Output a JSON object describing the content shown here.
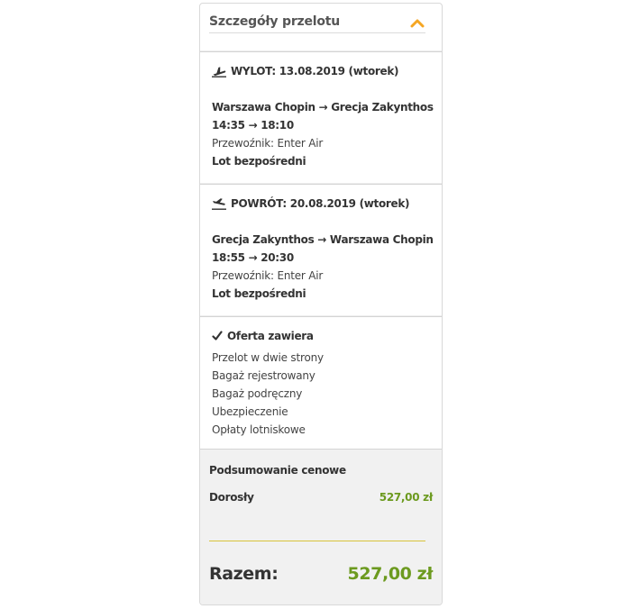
{
  "header": {
    "title": "Szczegóły przelotu",
    "toggle_icon": "chevron-up-icon",
    "accent_color": "#f5a623"
  },
  "outbound": {
    "icon": "plane-takeoff-icon",
    "heading": "WYLOT: 13.08.2019 (wtorek)",
    "route": "Warszawa Chopin → Grecja Zakynthos",
    "times": "14:35 → 18:10",
    "carrier": "Przewoźnik: Enter Air",
    "flight_type": "Lot bezpośredni"
  },
  "return": {
    "icon": "plane-landing-icon",
    "heading": "POWRÓT: 20.08.2019 (wtorek)",
    "route": "Grecja Zakynthos → Warszawa Chopin",
    "times": "18:55 → 20:30",
    "carrier": "Przewoźnik: Enter Air",
    "flight_type": "Lot bezpośredni"
  },
  "offer": {
    "icon": "checkmark-icon",
    "heading": "Oferta zawiera",
    "items": [
      "Przelot w dwie strony",
      "Bagaż rejestrowany",
      "Bagaż podręczny",
      "Ubezpieczenie",
      "Opłaty lotniskowe"
    ]
  },
  "summary": {
    "title": "Podsumowanie cenowe",
    "row_label": "Dorosły",
    "row_price": "527,00 zł",
    "total_label": "Razem:",
    "total_price": "527,00 zł",
    "price_color": "#6c9a1f"
  }
}
